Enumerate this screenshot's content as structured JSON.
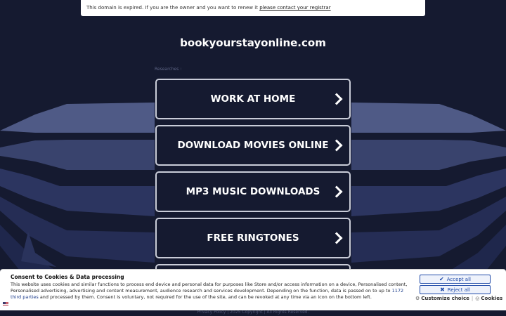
{
  "notice": {
    "text": "This domain is expired. If you are the owner and you want to renew it ",
    "link": "please contact your registrar"
  },
  "domain": "bookyourstayonline.com",
  "researches_label": "Researches :",
  "links": [
    {
      "label": "WORK AT HOME"
    },
    {
      "label": "DOWNLOAD MOVIES ONLINE"
    },
    {
      "label": "MP3 MUSIC DOWNLOADS"
    },
    {
      "label": "FREE RINGTONES"
    },
    {
      "label": ""
    }
  ],
  "footer": "Privacy Policy  |  2025 Copyright | All Rights Reserved.",
  "cookie": {
    "title": "Consent to Cookies & Data processing",
    "text_before": "This website uses cookies and similar functions to process end device and personal data for purposes like Store and/or access information on a device, Personalised content, Personalised advertising, advertising and content measurement, audience research and services development. Depending on the function, data is passed on to up to ",
    "third_parties": "1172 third parties",
    "text_after": " and processed by them. Consent is voluntary, not required for the use of the site, and can be revoked at any time via an icon on the bottom left.",
    "accept_label": "Accept all",
    "reject_label": "Reject all",
    "customize_label": "Customize choice",
    "separator": "|",
    "cookies_label": "Cookies"
  },
  "colors": {
    "background": "#151a30",
    "accent": "#1f4aa8"
  }
}
